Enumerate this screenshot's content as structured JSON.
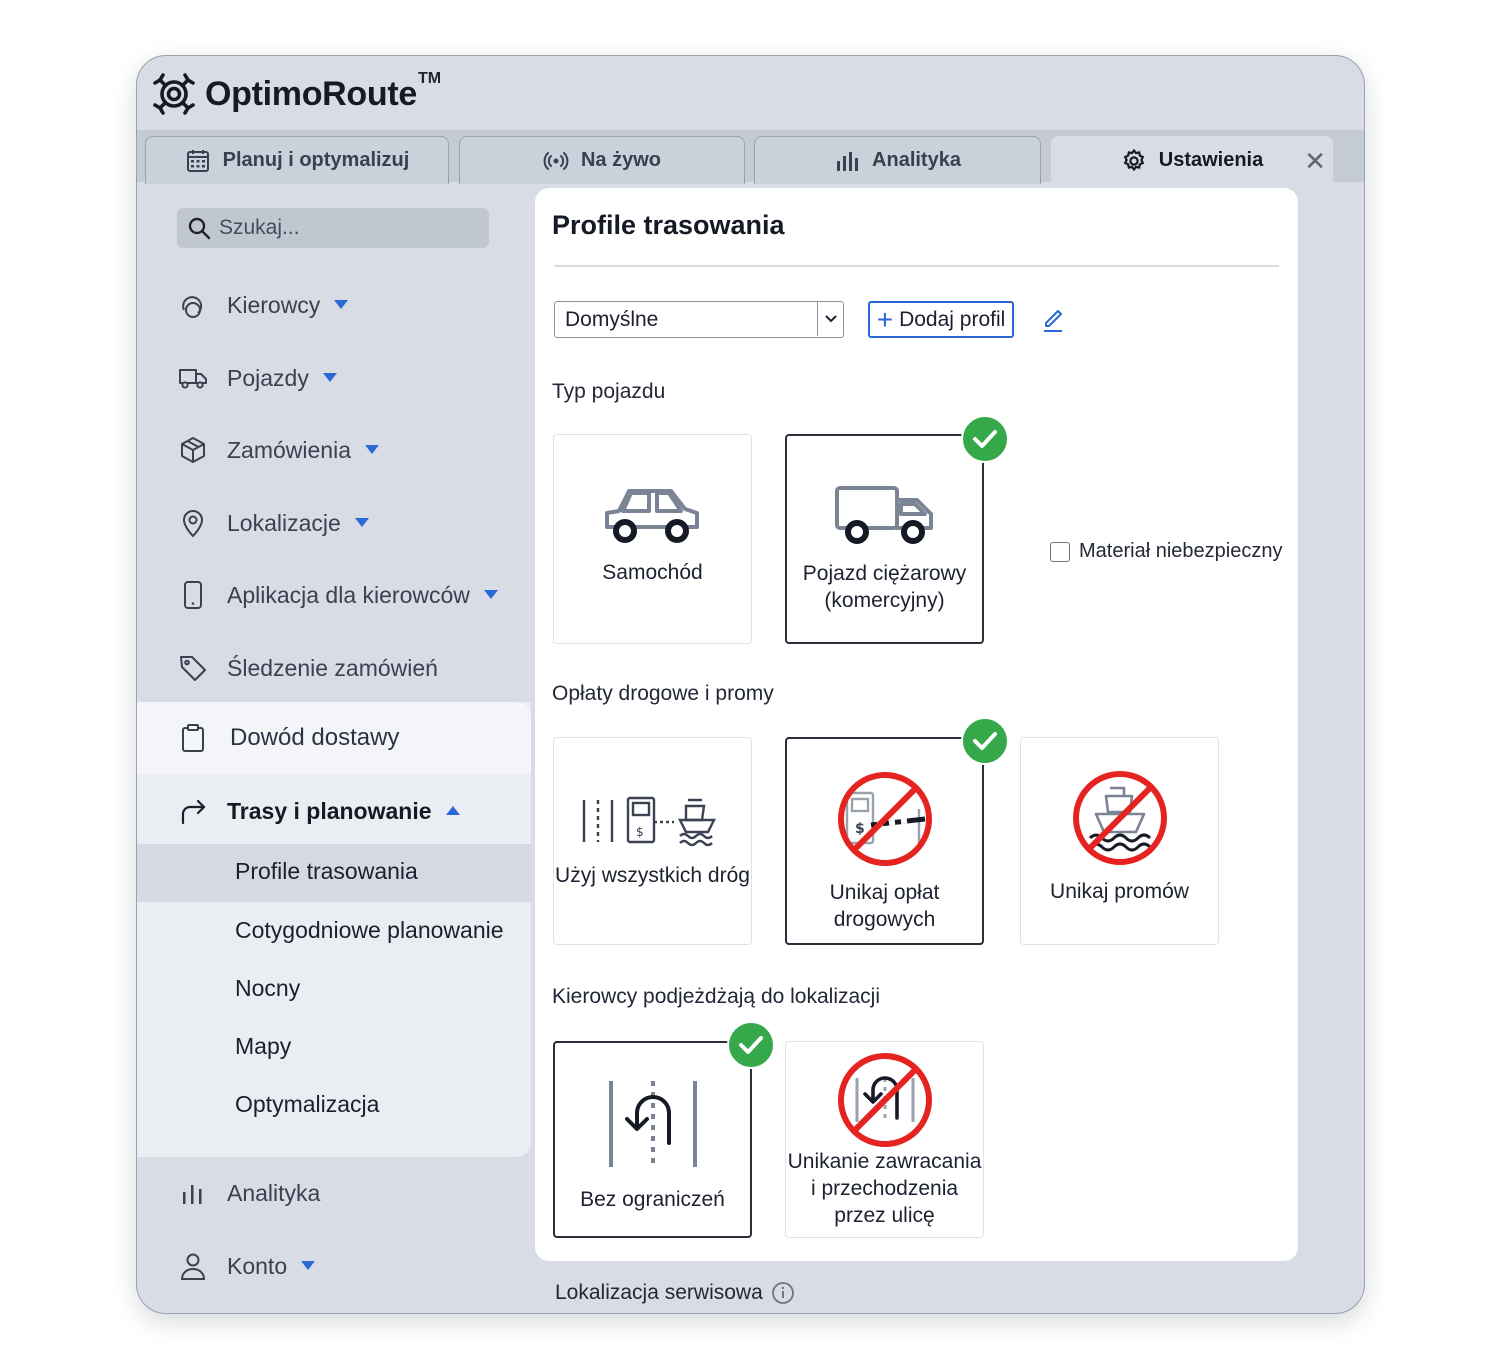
{
  "app": {
    "logo_text": "OptimoRoute",
    "logo_tm": "TM"
  },
  "tabs": [
    {
      "label": "Planuj i optymalizuj",
      "icon": "calendar-icon"
    },
    {
      "label": "Na żywo",
      "icon": "live-broadcast-icon"
    },
    {
      "label": "Analityka",
      "icon": "bar-chart-icon"
    },
    {
      "label": "Ustawienia",
      "icon": "gear-icon",
      "active": true
    }
  ],
  "sidebar": {
    "search_placeholder": "Szukaj...",
    "items": [
      {
        "label": "Kierowcy",
        "icon": "drivers-icon"
      },
      {
        "label": "Pojazdy",
        "icon": "truck-icon"
      },
      {
        "label": "Zamówienia",
        "icon": "package-icon"
      },
      {
        "label": "Lokalizacje",
        "icon": "location-pin-icon"
      },
      {
        "label": "Aplikacja dla kierowców",
        "icon": "phone-icon"
      },
      {
        "label": "Śledzenie zamówień",
        "icon": "tag-icon"
      },
      {
        "label": "Dowód dostawy",
        "icon": "clipboard-icon"
      },
      {
        "label": "Trasy i planowanie",
        "icon": "route-arrow-icon"
      },
      {
        "label": "Analityka",
        "icon": "analytics-icon"
      },
      {
        "label": "Konto",
        "icon": "user-icon"
      }
    ],
    "subitems": [
      {
        "label": "Profile trasowania"
      },
      {
        "label": "Cotygodniowe planowanie"
      },
      {
        "label": "Nocny"
      },
      {
        "label": "Mapy"
      },
      {
        "label": "Optymalizacja"
      }
    ]
  },
  "main": {
    "title": "Profile trasowania",
    "profile_select": "Domyślne",
    "add_profile_label": "Dodaj profil",
    "vehicle_section": "Typ pojazdu",
    "vehicle_options": [
      {
        "label": "Samochód",
        "selected": false
      },
      {
        "label": "Pojazd ciężarowy\n(komercyjny)",
        "selected": true
      }
    ],
    "hazmat_label": "Materiał niebezpieczny",
    "hazmat_checked": false,
    "toll_section": "Opłaty drogowe i promy",
    "toll_options": [
      {
        "label": "Użyj wszystkich dróg",
        "selected": false
      },
      {
        "label": "Unikaj opłat\ndrogowych",
        "selected": true
      },
      {
        "label": "Unikaj promów",
        "selected": false
      }
    ],
    "approach_section": "Kierowcy podjeżdżają do lokalizacji",
    "approach_options": [
      {
        "label": "Bez ograniczeń",
        "selected": true
      },
      {
        "label": "Unikanie zawracania\ni przechodzenia\nprzez ulicę",
        "selected": false
      }
    ],
    "service_location_label": "Lokalizacja serwisowa"
  },
  "colors": {
    "accent": "#2a68d6",
    "check": "#35a84a",
    "prohibit": "#e52421"
  }
}
